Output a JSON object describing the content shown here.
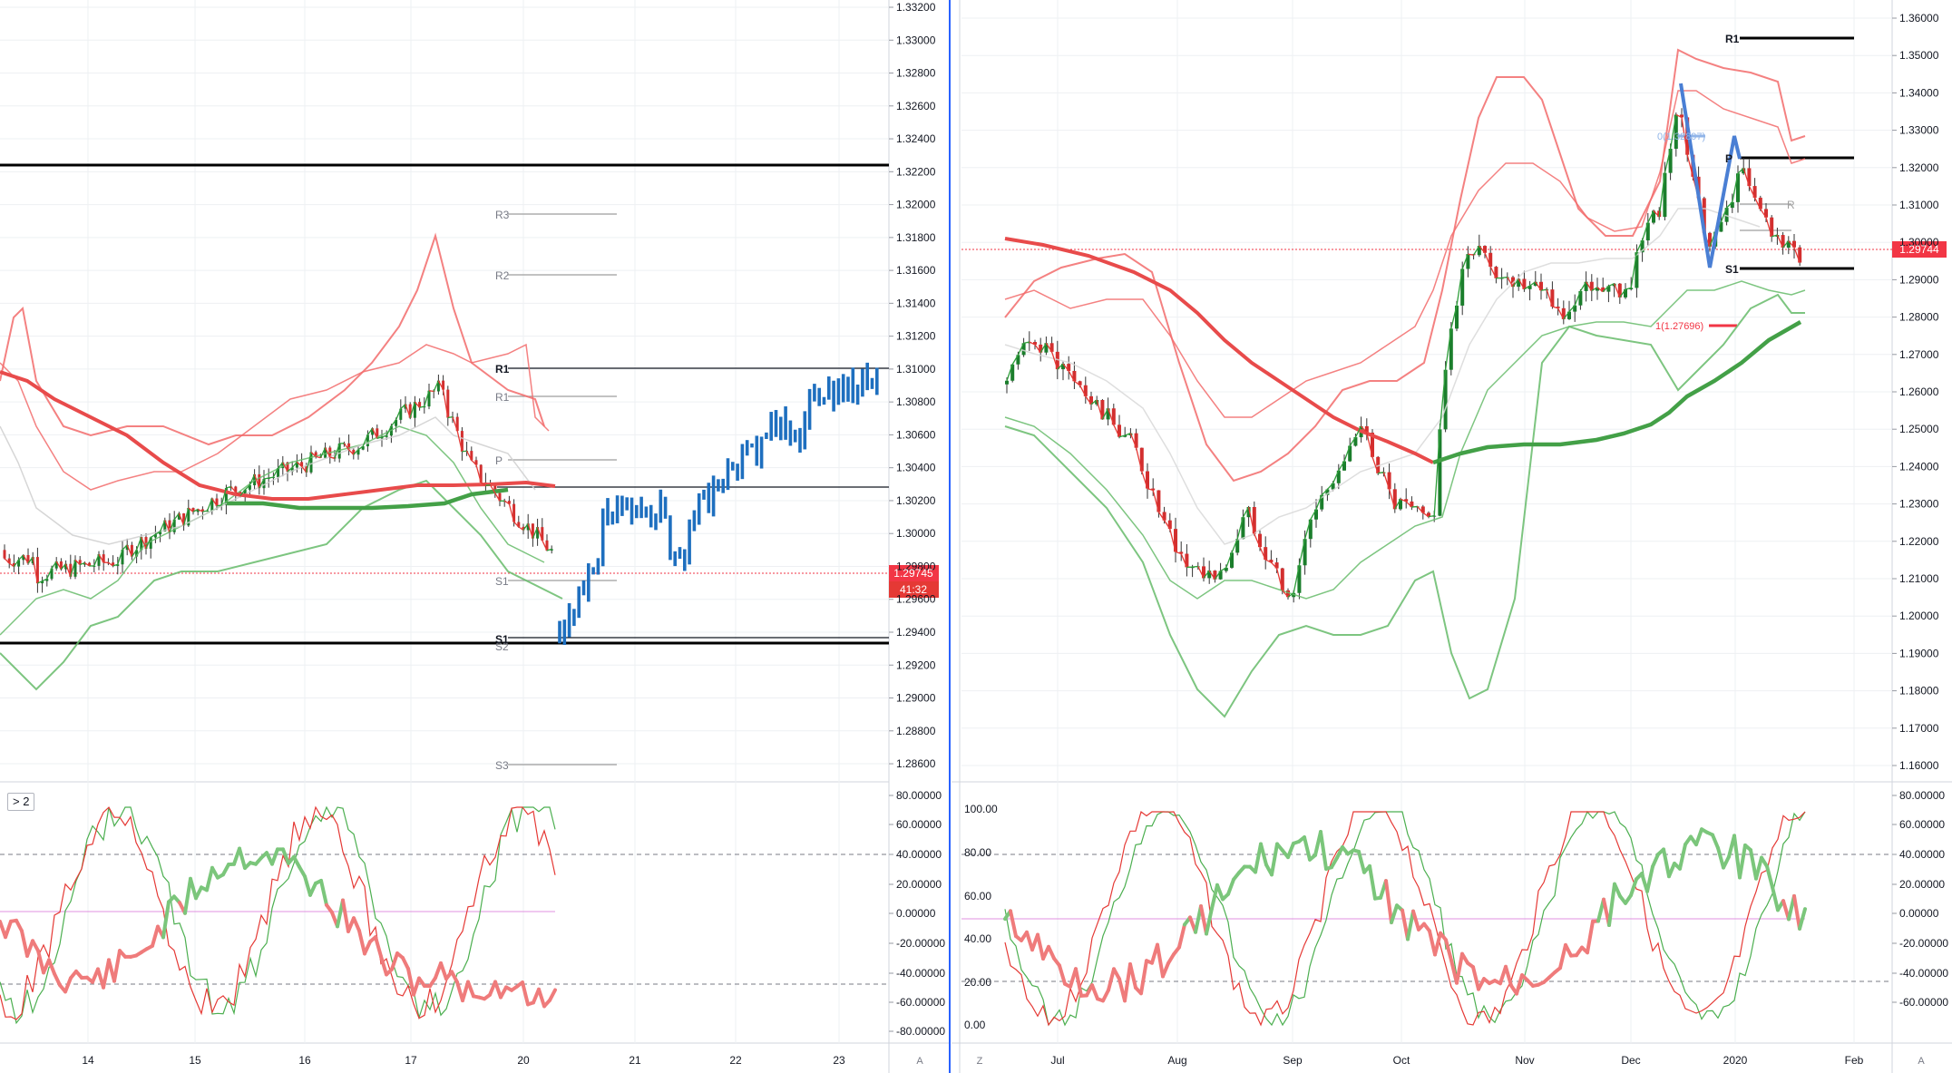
{
  "colors": {
    "up": "#089981",
    "down": "#f23645",
    "blue_bars": "#1e6fbf",
    "bb_red": "#f26b6b",
    "bb_green": "#66bb6a",
    "ma_red": "#e84b4b",
    "ma_green": "#43a047",
    "grid": "#eef0f3",
    "axis_text": "#131722",
    "price_tag": "#f23645"
  },
  "left_chart": {
    "price_axis_labels": [
      "1.33200",
      "1.33000",
      "1.32800",
      "1.32600",
      "1.32400",
      "1.32200",
      "1.32000",
      "1.31800",
      "1.31600",
      "1.31400",
      "1.31200",
      "1.31000",
      "1.30800",
      "1.30600",
      "1.30400",
      "1.30200",
      "1.30000",
      "1.29800",
      "1.29600",
      "1.29400",
      "1.29200",
      "1.29000",
      "1.28800",
      "1.28600"
    ],
    "osc_axis_labels": [
      "80.00000",
      "60.00000",
      "40.00000",
      "20.00000",
      "0.00000",
      "-20.00000",
      "-40.00000",
      "-60.00000",
      "-80.00000"
    ],
    "time_labels": [
      "14",
      "15",
      "16",
      "17",
      "20",
      "20",
      "21",
      "22",
      "23"
    ],
    "axis_corner": "A",
    "last_price_tag": "1.29745",
    "countdown_tag": "41:32",
    "level_labels": {
      "r3": "R3",
      "r2": "R2",
      "r1_grey": "R1",
      "r1_black": "R1",
      "p": "P",
      "s1_grey": "S1",
      "s1_black": "S1",
      "s2": "S2",
      "s3": "S3"
    },
    "osc_chip": "> 2"
  },
  "right_chart": {
    "price_axis_labels": [
      "1.36000",
      "1.35000",
      "1.34000",
      "1.33000",
      "1.32000",
      "1.31000",
      "1.30000",
      "1.29000",
      "1.28000",
      "1.27000",
      "1.26000",
      "1.25000",
      "1.24000",
      "1.23000",
      "1.22000",
      "1.21000",
      "1.20000",
      "1.19000",
      "1.18000",
      "1.17000",
      "1.16000"
    ],
    "osc_left_labels": [
      "100.00",
      "80.00",
      "60.00",
      "40.00",
      "20.00",
      "0.00"
    ],
    "osc_right_labels": [
      "80.00000",
      "60.00000",
      "40.00000",
      "20.00000",
      "0.00000",
      "-20.00000",
      "-40.00000",
      "-60.00000"
    ],
    "time_labels": [
      "Jul",
      "Aug",
      "Sep",
      "Oct",
      "Nov",
      "Dec",
      "2020",
      "Feb"
    ],
    "axis_corner_left": "Z",
    "axis_corner_right": "A",
    "last_price_tag": "1.29744",
    "level_labels": {
      "r1": "R1",
      "p": "P",
      "s1": "S1",
      "fib_top": "0(1.32897)",
      "fib_bottom": "1(1.27696)",
      "r_grey": "R"
    }
  },
  "chart_data": [
    {
      "type": "line",
      "title": "",
      "xlabel": "",
      "ylabel": "",
      "x": [
        "14",
        "15",
        "16",
        "17",
        "20",
        "21",
        "22",
        "23"
      ],
      "ylim": [
        1.2849,
        1.3322
      ],
      "series": [],
      "levels": [
        {
          "label": "R3",
          "value": 1.3195
        },
        {
          "label": "R2",
          "value": 1.3157
        },
        {
          "label": "R1",
          "value": 1.31
        },
        {
          "label": "P",
          "value": 1.3043
        },
        {
          "label": "S1",
          "value": 1.298
        },
        {
          "label": "S1",
          "value": 1.2932
        },
        {
          "label": "S3",
          "value": 1.2858
        }
      ],
      "last_price": 1.29745,
      "grid": true
    },
    {
      "type": "line",
      "title": "",
      "xlabel": "",
      "ylabel": "",
      "x": [
        "Jul",
        "Aug",
        "Sep",
        "Oct",
        "Nov",
        "Dec",
        "2020",
        "Feb"
      ],
      "ylim": [
        1.155,
        1.362
      ],
      "series": [],
      "levels": [
        {
          "label": "R1",
          "value": 1.3545
        },
        {
          "label": "P",
          "value": 1.3222
        },
        {
          "label": "S1",
          "value": 1.292
        },
        {
          "label": "0(1.32897)",
          "value": 1.32897
        },
        {
          "label": "1(1.27696)",
          "value": 1.27696
        }
      ],
      "last_price": 1.29744,
      "grid": true
    }
  ]
}
